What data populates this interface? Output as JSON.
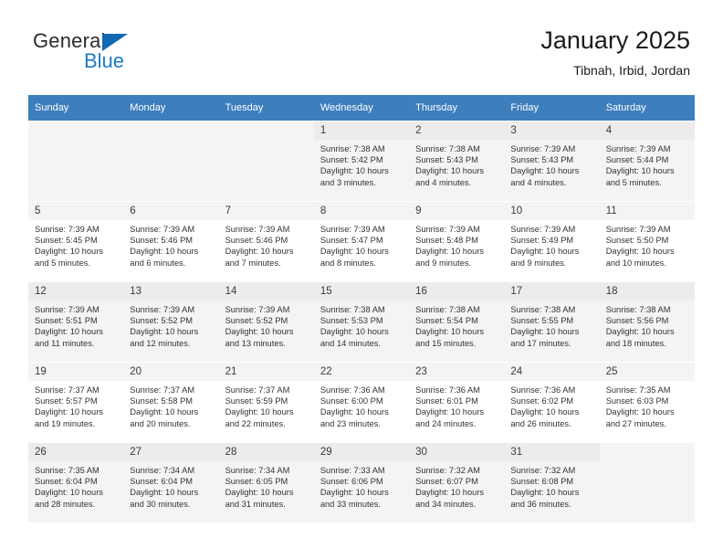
{
  "brand": {
    "name_part1": "General",
    "name_part2": "Blue",
    "logo_icon": "blue-triangle-icon"
  },
  "header": {
    "title": "January 2025",
    "subtitle": "Tibnah, Irbid, Jordan"
  },
  "colors": {
    "header_blue": "#3d7ebd",
    "brand_blue": "#1a7cc4",
    "logo_triangle": "#1268b3",
    "row_shade": "#f4f4f4",
    "daynum_band": "#ececec",
    "text": "#333333"
  },
  "weekday_headers": [
    "Sunday",
    "Monday",
    "Tuesday",
    "Wednesday",
    "Thursday",
    "Friday",
    "Saturday"
  ],
  "labels": {
    "sunrise_prefix": "Sunrise:",
    "sunset_prefix": "Sunset:",
    "daylight_prefix": "Daylight:"
  },
  "weeks": [
    [
      {
        "day": "",
        "lines": []
      },
      {
        "day": "",
        "lines": []
      },
      {
        "day": "",
        "lines": []
      },
      {
        "day": "1",
        "lines": [
          "Sunrise: 7:38 AM",
          "Sunset: 5:42 PM",
          "Daylight: 10 hours and 3 minutes."
        ]
      },
      {
        "day": "2",
        "lines": [
          "Sunrise: 7:38 AM",
          "Sunset: 5:43 PM",
          "Daylight: 10 hours and 4 minutes."
        ]
      },
      {
        "day": "3",
        "lines": [
          "Sunrise: 7:39 AM",
          "Sunset: 5:43 PM",
          "Daylight: 10 hours and 4 minutes."
        ]
      },
      {
        "day": "4",
        "lines": [
          "Sunrise: 7:39 AM",
          "Sunset: 5:44 PM",
          "Daylight: 10 hours and 5 minutes."
        ]
      }
    ],
    [
      {
        "day": "5",
        "lines": [
          "Sunrise: 7:39 AM",
          "Sunset: 5:45 PM",
          "Daylight: 10 hours and 5 minutes."
        ]
      },
      {
        "day": "6",
        "lines": [
          "Sunrise: 7:39 AM",
          "Sunset: 5:46 PM",
          "Daylight: 10 hours and 6 minutes."
        ]
      },
      {
        "day": "7",
        "lines": [
          "Sunrise: 7:39 AM",
          "Sunset: 5:46 PM",
          "Daylight: 10 hours and 7 minutes."
        ]
      },
      {
        "day": "8",
        "lines": [
          "Sunrise: 7:39 AM",
          "Sunset: 5:47 PM",
          "Daylight: 10 hours and 8 minutes."
        ]
      },
      {
        "day": "9",
        "lines": [
          "Sunrise: 7:39 AM",
          "Sunset: 5:48 PM",
          "Daylight: 10 hours and 9 minutes."
        ]
      },
      {
        "day": "10",
        "lines": [
          "Sunrise: 7:39 AM",
          "Sunset: 5:49 PM",
          "Daylight: 10 hours and 9 minutes."
        ]
      },
      {
        "day": "11",
        "lines": [
          "Sunrise: 7:39 AM",
          "Sunset: 5:50 PM",
          "Daylight: 10 hours and 10 minutes."
        ]
      }
    ],
    [
      {
        "day": "12",
        "lines": [
          "Sunrise: 7:39 AM",
          "Sunset: 5:51 PM",
          "Daylight: 10 hours and 11 minutes."
        ]
      },
      {
        "day": "13",
        "lines": [
          "Sunrise: 7:39 AM",
          "Sunset: 5:52 PM",
          "Daylight: 10 hours and 12 minutes."
        ]
      },
      {
        "day": "14",
        "lines": [
          "Sunrise: 7:39 AM",
          "Sunset: 5:52 PM",
          "Daylight: 10 hours and 13 minutes."
        ]
      },
      {
        "day": "15",
        "lines": [
          "Sunrise: 7:38 AM",
          "Sunset: 5:53 PM",
          "Daylight: 10 hours and 14 minutes."
        ]
      },
      {
        "day": "16",
        "lines": [
          "Sunrise: 7:38 AM",
          "Sunset: 5:54 PM",
          "Daylight: 10 hours and 15 minutes."
        ]
      },
      {
        "day": "17",
        "lines": [
          "Sunrise: 7:38 AM",
          "Sunset: 5:55 PM",
          "Daylight: 10 hours and 17 minutes."
        ]
      },
      {
        "day": "18",
        "lines": [
          "Sunrise: 7:38 AM",
          "Sunset: 5:56 PM",
          "Daylight: 10 hours and 18 minutes."
        ]
      }
    ],
    [
      {
        "day": "19",
        "lines": [
          "Sunrise: 7:37 AM",
          "Sunset: 5:57 PM",
          "Daylight: 10 hours and 19 minutes."
        ]
      },
      {
        "day": "20",
        "lines": [
          "Sunrise: 7:37 AM",
          "Sunset: 5:58 PM",
          "Daylight: 10 hours and 20 minutes."
        ]
      },
      {
        "day": "21",
        "lines": [
          "Sunrise: 7:37 AM",
          "Sunset: 5:59 PM",
          "Daylight: 10 hours and 22 minutes."
        ]
      },
      {
        "day": "22",
        "lines": [
          "Sunrise: 7:36 AM",
          "Sunset: 6:00 PM",
          "Daylight: 10 hours and 23 minutes."
        ]
      },
      {
        "day": "23",
        "lines": [
          "Sunrise: 7:36 AM",
          "Sunset: 6:01 PM",
          "Daylight: 10 hours and 24 minutes."
        ]
      },
      {
        "day": "24",
        "lines": [
          "Sunrise: 7:36 AM",
          "Sunset: 6:02 PM",
          "Daylight: 10 hours and 26 minutes."
        ]
      },
      {
        "day": "25",
        "lines": [
          "Sunrise: 7:35 AM",
          "Sunset: 6:03 PM",
          "Daylight: 10 hours and 27 minutes."
        ]
      }
    ],
    [
      {
        "day": "26",
        "lines": [
          "Sunrise: 7:35 AM",
          "Sunset: 6:04 PM",
          "Daylight: 10 hours and 28 minutes."
        ]
      },
      {
        "day": "27",
        "lines": [
          "Sunrise: 7:34 AM",
          "Sunset: 6:04 PM",
          "Daylight: 10 hours and 30 minutes."
        ]
      },
      {
        "day": "28",
        "lines": [
          "Sunrise: 7:34 AM",
          "Sunset: 6:05 PM",
          "Daylight: 10 hours and 31 minutes."
        ]
      },
      {
        "day": "29",
        "lines": [
          "Sunrise: 7:33 AM",
          "Sunset: 6:06 PM",
          "Daylight: 10 hours and 33 minutes."
        ]
      },
      {
        "day": "30",
        "lines": [
          "Sunrise: 7:32 AM",
          "Sunset: 6:07 PM",
          "Daylight: 10 hours and 34 minutes."
        ]
      },
      {
        "day": "31",
        "lines": [
          "Sunrise: 7:32 AM",
          "Sunset: 6:08 PM",
          "Daylight: 10 hours and 36 minutes."
        ]
      },
      {
        "day": "",
        "lines": []
      }
    ]
  ]
}
